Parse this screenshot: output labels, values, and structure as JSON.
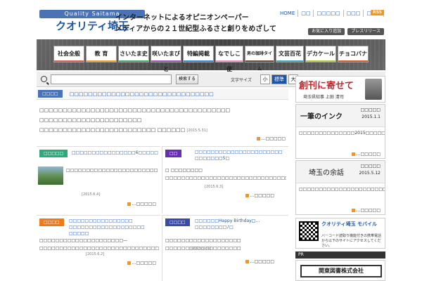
{
  "header": {
    "logo_top": "Quality Saitama",
    "logo_main": "クオリティ埼玉",
    "tagline1": "インターネットによるオピニオンペーパー",
    "tagline2": "メディアからの２１世紀型ふるさと創りをめざして",
    "topnav": [
      "HOME",
      "□□",
      "□□□□□",
      "□□□",
      "□□□"
    ],
    "rss": "RSS",
    "sub_buttons": [
      "お気に入り追加",
      "プレスリリース"
    ]
  },
  "nav": [
    {
      "label": "社会全般",
      "bar": "#e05a5a"
    },
    {
      "label": "教 育",
      "bar": "#f0a030"
    },
    {
      "label": "さいたま史",
      "bar": "#49a86b"
    },
    {
      "label": "咲いたまびと",
      "bar": "#9b59b6"
    },
    {
      "label": "特編掲載",
      "bar": "#3a87d1"
    },
    {
      "label": "なでしこ便",
      "bar": "#e98fc1"
    },
    {
      "label": "男の珈琲タイム",
      "bar": "#6b4c32"
    },
    {
      "label": "文芸百花",
      "bar": "#3ea9b5"
    },
    {
      "label": "デカケール",
      "bar": "#b7c93a"
    },
    {
      "label": "チョコバナ",
      "bar": "#d95a2b"
    }
  ],
  "search": {
    "placeholder": "",
    "button": "検索する",
    "fontsize_label": "文字サイズ",
    "sizes": [
      "小",
      "標準",
      "大"
    ]
  },
  "main": {
    "featured": {
      "category": "□□□□",
      "category_color": "#4a73b5",
      "title": "□□□□□□□□□□□□□□□□□□□□□□□□□□□□□□□",
      "body1": "□□□□□□□□□□□□□□□□□□□□□□□□□□□□□□□□□□□□□□□□□ □□□□□□□□□□□□□□□□□□□□□□",
      "body2": "□□□□□□□□□□□□□□□□□□□□□□□□□ □□□□□□",
      "date": "[2015.5.31]",
      "more": "…□□□□□"
    },
    "grid": [
      {
        "category": "□□□□□",
        "color": "#2bab7d",
        "title": "□□□□□□□□□□□□□□□□6□□□□□",
        "body": "□□□□□□□□□□□□□□□□□□□□□□□□□□□□□□□□□□□□□□□□□□□□□□□□□□□□□□□□□□□□",
        "date": "[2015.6.4]",
        "more": "…□□□□□"
      },
      {
        "category": "□□",
        "color": "#6a2eb5",
        "title": "□□□□□□□□□□□□□□□□□□□□□□ □□□□□□□5□",
        "body": "□ □□□□□□□□ □□□□□□□□□□□□□□□□□□□□□□□□□□□□□□□□□□□□□□□□□□□□□□□",
        "date": "[2015.6.3]",
        "more": "…□□□□□"
      },
      {
        "category": "□□□□",
        "color": "#f07a1a",
        "title": "□□□□□□□□□□□□□□□□ □□□□□□□□□□□□□□□□□□□ □□□□□",
        "body": "□□□□□□□□□□□□□□□□□□□□□—□□□□□□□□□□□□□□□□□□□□□□□□□□□□□□□□□□□□",
        "date": "[2015.6.2]",
        "more": "…□□□□□"
      },
      {
        "category": "□□□□",
        "color": "#3a4aa8",
        "title": "□□□□□□Happy Birthday□…□□□□□□□□♪□",
        "body": "□□□□□□□□□□□□□□□□□□□ □□□□□□□□□□□□□□□□□□□ □□□□□□□□□□□□□□□□□",
        "date": "[2015.5.31]",
        "more": "…□□□□□"
      }
    ]
  },
  "side": {
    "souken": {
      "title": "創刊に寄せて",
      "sub": "埼玉県知事 上田 清司"
    },
    "ink": {
      "title": "一筆のインク",
      "sub": "□□□□□",
      "date": "2015.1.1",
      "text": "□□□□□□□□□□□□□□2015□□□□□□□□□□□□□□□□□□□□□□□□□□□2015□□□□□□□□□□□□□",
      "more": "…□□□□□"
    },
    "yoyo": {
      "title": "埼玉の余話",
      "sub": "□□□□□",
      "date": "2015.5.12",
      "text": "□□□□□□□□□□□□□□□□□□□□□□□□□□□□□□□□□□GO□□□□□□□□□□□□□□□□□□□□□□□□□□□□□□",
      "more": "…□□□□□"
    },
    "mobile": {
      "title": "クオリティ埼玉 モバイル",
      "text": "バーコード読取り機能付きの携帯電話から以下のサイトにアクセスしてください。"
    },
    "pr": "PR",
    "sponsor": "関東図書株式会社"
  }
}
